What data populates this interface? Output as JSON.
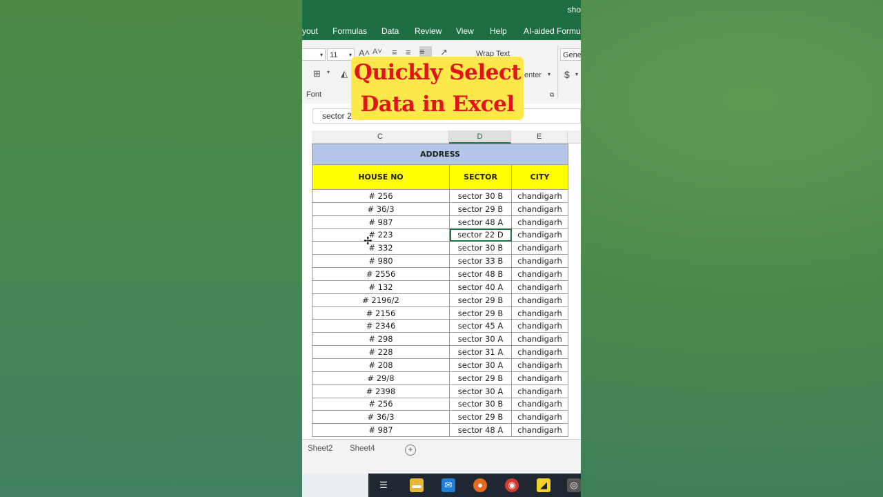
{
  "window": {
    "title": "sho"
  },
  "menu": [
    "yout",
    "Formulas",
    "Data",
    "Review",
    "View",
    "Help",
    "AI-aided Formula"
  ],
  "ribbon": {
    "font_size": "11",
    "wrap_text": "Wrap Text",
    "merge_center": "enter",
    "currency": "$",
    "number_format": "Gene",
    "font_group": "Font"
  },
  "overlay": {
    "line1": "Quickly Select",
    "line2": "Data in Excel"
  },
  "formula_bar": {
    "value": "sector 22"
  },
  "columns": [
    "C",
    "D",
    "E"
  ],
  "active_column": "D",
  "table": {
    "title": "ADDRESS",
    "headers": [
      "HOUSE NO",
      "SECTOR",
      "CITY"
    ],
    "rows": [
      [
        "# 256",
        "sector 30 B",
        "chandigarh"
      ],
      [
        "# 36/3",
        "sector 29 B",
        "chandigarh"
      ],
      [
        "# 987",
        "sector 48 A",
        "chandigarh"
      ],
      [
        "# 223",
        "sector 22 D",
        "chandigarh"
      ],
      [
        "# 332",
        "sector 30 B",
        "chandigarh"
      ],
      [
        "# 980",
        "sector 33 B",
        "chandigarh"
      ],
      [
        "# 2556",
        "sector 48 B",
        "chandigarh"
      ],
      [
        "# 132",
        "sector 40 A",
        "chandigarh"
      ],
      [
        "# 2196/2",
        "sector 29 B",
        "chandigarh"
      ],
      [
        "# 2156",
        "sector 29 B",
        "chandigarh"
      ],
      [
        "# 2346",
        "sector 45 A",
        "chandigarh"
      ],
      [
        "# 298",
        "sector 30 A",
        "chandigarh"
      ],
      [
        "# 228",
        "sector 31 A",
        "chandigarh"
      ],
      [
        "# 208",
        "sector 30 A",
        "chandigarh"
      ],
      [
        "# 29/8",
        "sector 29 B",
        "chandigarh"
      ],
      [
        "# 2398",
        "sector 30 A",
        "chandigarh"
      ],
      [
        "# 256",
        "sector 30 B",
        "chandigarh"
      ],
      [
        "# 36/3",
        "sector 29 B",
        "chandigarh"
      ],
      [
        "# 987",
        "sector 48 A",
        "chandigarh"
      ]
    ],
    "selected_row": 3,
    "selected_col": 1
  },
  "sheets": [
    "Sheet2",
    "Sheet4"
  ],
  "add_sheet_glyph": "+",
  "colors": {
    "excel_green": "#1e6e43",
    "address_fill": "#b4c6e7",
    "header_fill": "#ffff00",
    "overlay_fill": "#fde84a",
    "overlay_text": "#e3131b"
  }
}
